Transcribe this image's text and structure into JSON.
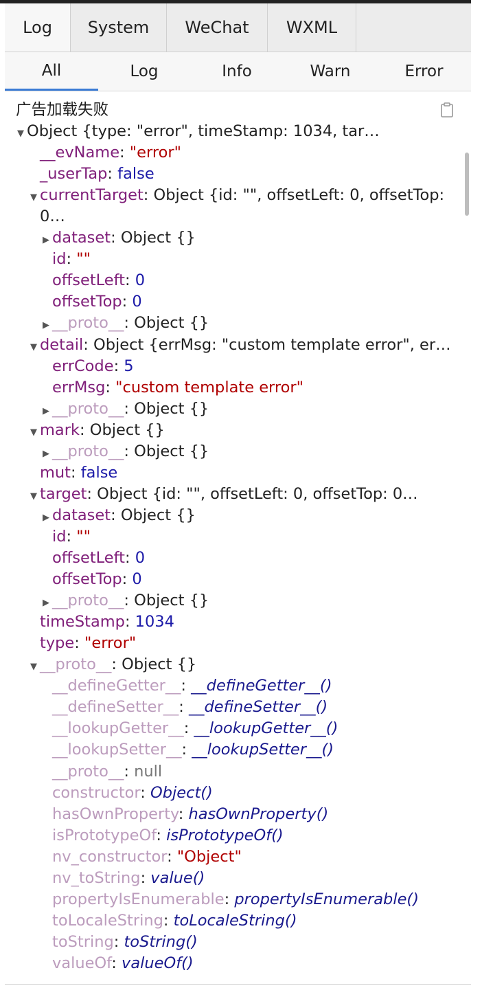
{
  "tabs_top": [
    {
      "label": "Log",
      "active": true
    },
    {
      "label": "System",
      "active": false
    },
    {
      "label": "WeChat",
      "active": false
    },
    {
      "label": "WXML",
      "active": false
    }
  ],
  "tabs_filter": [
    {
      "label": "All",
      "active": true
    },
    {
      "label": "Log",
      "active": false
    },
    {
      "label": "Info",
      "active": false
    },
    {
      "label": "Warn",
      "active": false
    },
    {
      "label": "Error",
      "active": false
    }
  ],
  "console": {
    "message": "广告加载失败",
    "lines": [
      {
        "arrow": "down",
        "indent": 0,
        "key": "",
        "sep": "",
        "value": "Object {type: \"error\", timeStamp: 1034, tar…",
        "vtype": "obj"
      },
      {
        "arrow": "",
        "indent": 1,
        "key": "__evName",
        "sep": ": ",
        "value": "\"error\"",
        "vtype": "str"
      },
      {
        "arrow": "",
        "indent": 1,
        "key": "_userTap",
        "sep": ": ",
        "value": "false",
        "vtype": "kw"
      },
      {
        "arrow": "down",
        "indent": 1,
        "key": "currentTarget",
        "sep": ": ",
        "value": "Object {id: \"\", offsetLeft: 0, offsetTop:",
        "vtype": "obj"
      },
      {
        "arrow": "",
        "indent": 1,
        "key": "",
        "sep": "",
        "value": "0…",
        "vtype": "obj"
      },
      {
        "arrow": "right",
        "indent": 2,
        "key": "dataset",
        "sep": ": ",
        "value": "Object {}",
        "vtype": "obj"
      },
      {
        "arrow": "",
        "indent": 2,
        "key": "id",
        "sep": ": ",
        "value": "\"\"",
        "vtype": "str"
      },
      {
        "arrow": "",
        "indent": 2,
        "key": "offsetLeft",
        "sep": ": ",
        "value": "0",
        "vtype": "num"
      },
      {
        "arrow": "",
        "indent": 2,
        "key": "offsetTop",
        "sep": ": ",
        "value": "0",
        "vtype": "num"
      },
      {
        "arrow": "right",
        "indent": 2,
        "key": "__proto__",
        "sep": ": ",
        "value": "Object {}",
        "vtype": "obj",
        "dim": true
      },
      {
        "arrow": "down",
        "indent": 1,
        "key": "detail",
        "sep": ": ",
        "value": "Object {errMsg: \"custom template error\", er…",
        "vtype": "obj"
      },
      {
        "arrow": "",
        "indent": 2,
        "key": "errCode",
        "sep": ": ",
        "value": "5",
        "vtype": "num"
      },
      {
        "arrow": "",
        "indent": 2,
        "key": "errMsg",
        "sep": ": ",
        "value": "\"custom template error\"",
        "vtype": "str"
      },
      {
        "arrow": "right",
        "indent": 2,
        "key": "__proto__",
        "sep": ": ",
        "value": "Object {}",
        "vtype": "obj",
        "dim": true
      },
      {
        "arrow": "down",
        "indent": 1,
        "key": "mark",
        "sep": ": ",
        "value": "Object {}",
        "vtype": "obj"
      },
      {
        "arrow": "right",
        "indent": 2,
        "key": "__proto__",
        "sep": ": ",
        "value": "Object {}",
        "vtype": "obj",
        "dim": true
      },
      {
        "arrow": "",
        "indent": 1,
        "key": "mut",
        "sep": ": ",
        "value": "false",
        "vtype": "kw"
      },
      {
        "arrow": "down",
        "indent": 1,
        "key": "target",
        "sep": ": ",
        "value": "Object {id: \"\", offsetLeft: 0, offsetTop: 0…",
        "vtype": "obj"
      },
      {
        "arrow": "right",
        "indent": 2,
        "key": "dataset",
        "sep": ": ",
        "value": "Object {}",
        "vtype": "obj"
      },
      {
        "arrow": "",
        "indent": 2,
        "key": "id",
        "sep": ": ",
        "value": "\"\"",
        "vtype": "str"
      },
      {
        "arrow": "",
        "indent": 2,
        "key": "offsetLeft",
        "sep": ": ",
        "value": "0",
        "vtype": "num"
      },
      {
        "arrow": "",
        "indent": 2,
        "key": "offsetTop",
        "sep": ": ",
        "value": "0",
        "vtype": "num"
      },
      {
        "arrow": "right",
        "indent": 2,
        "key": "__proto__",
        "sep": ": ",
        "value": "Object {}",
        "vtype": "obj",
        "dim": true
      },
      {
        "arrow": "",
        "indent": 1,
        "key": "timeStamp",
        "sep": ": ",
        "value": "1034",
        "vtype": "num"
      },
      {
        "arrow": "",
        "indent": 1,
        "key": "type",
        "sep": ": ",
        "value": "\"error\"",
        "vtype": "str"
      },
      {
        "arrow": "down",
        "indent": 1,
        "key": "__proto__",
        "sep": ": ",
        "value": "Object {}",
        "vtype": "obj",
        "dim": true
      },
      {
        "arrow": "",
        "indent": 2,
        "key": "__defineGetter__",
        "sep": ": ",
        "value": "__defineGetter__()",
        "vtype": "func",
        "dim": true
      },
      {
        "arrow": "",
        "indent": 2,
        "key": "__defineSetter__",
        "sep": ": ",
        "value": "__defineSetter__()",
        "vtype": "func",
        "dim": true
      },
      {
        "arrow": "",
        "indent": 2,
        "key": "__lookupGetter__",
        "sep": ": ",
        "value": "__lookupGetter__()",
        "vtype": "func",
        "dim": true
      },
      {
        "arrow": "",
        "indent": 2,
        "key": "__lookupSetter__",
        "sep": ": ",
        "value": "__lookupSetter__()",
        "vtype": "func",
        "dim": true
      },
      {
        "arrow": "",
        "indent": 2,
        "key": "__proto__",
        "sep": ": ",
        "value": "null",
        "vtype": "nul",
        "dim": true
      },
      {
        "arrow": "",
        "indent": 2,
        "key": "constructor",
        "sep": ": ",
        "value": "Object()",
        "vtype": "func",
        "dim": true
      },
      {
        "arrow": "",
        "indent": 2,
        "key": "hasOwnProperty",
        "sep": ": ",
        "value": "hasOwnProperty()",
        "vtype": "func",
        "dim": true
      },
      {
        "arrow": "",
        "indent": 2,
        "key": "isPrototypeOf",
        "sep": ": ",
        "value": "isPrototypeOf()",
        "vtype": "func",
        "dim": true
      },
      {
        "arrow": "",
        "indent": 2,
        "key": "nv_constructor",
        "sep": ": ",
        "value": "\"Object\"",
        "vtype": "str",
        "dim": true
      },
      {
        "arrow": "",
        "indent": 2,
        "key": "nv_toString",
        "sep": ": ",
        "value": "value()",
        "vtype": "func",
        "dim": true
      },
      {
        "arrow": "",
        "indent": 2,
        "key": "propertyIsEnumerable",
        "sep": ": ",
        "value": "propertyIsEnumerable()",
        "vtype": "func",
        "dim": true
      },
      {
        "arrow": "",
        "indent": 2,
        "key": "toLocaleString",
        "sep": ": ",
        "value": "toLocaleString()",
        "vtype": "func",
        "dim": true
      },
      {
        "arrow": "",
        "indent": 2,
        "key": "toString",
        "sep": ": ",
        "value": "toString()",
        "vtype": "func",
        "dim": true
      },
      {
        "arrow": "",
        "indent": 2,
        "key": "valueOf",
        "sep": ": ",
        "value": "valueOf()",
        "vtype": "func",
        "dim": true
      }
    ]
  },
  "icons": {
    "copy": "clipboard-icon"
  },
  "colors": {
    "active_tab_underline": "#3a7bd5",
    "key": "#80207a",
    "string": "#b00000",
    "number": "#1c1aa8"
  }
}
